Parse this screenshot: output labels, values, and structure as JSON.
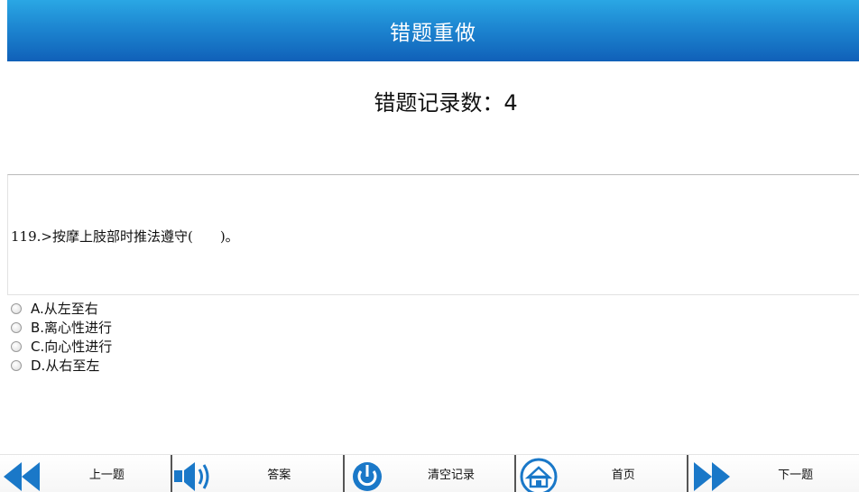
{
  "header": {
    "title": "错题重做"
  },
  "summary": {
    "record_count_text": "错题记录数：4"
  },
  "question": {
    "text": "119.>按摩上肢部时推法遵守(　　)。",
    "options": [
      {
        "label": "A.从左至右"
      },
      {
        "label": "B.离心性进行"
      },
      {
        "label": "C.向心性进行"
      },
      {
        "label": "D.从右至左"
      }
    ]
  },
  "toolbar": {
    "items": [
      {
        "label": "上一题",
        "icon": "previous-icon"
      },
      {
        "label": "答案",
        "icon": "speaker-icon"
      },
      {
        "label": "清空记录",
        "icon": "power-icon"
      },
      {
        "label": "首页",
        "icon": "home-icon"
      },
      {
        "label": "下一题",
        "icon": "next-icon"
      }
    ]
  },
  "colors": {
    "header_top": "#2aa7e4",
    "header_bottom": "#1060b8",
    "icon_blue": "#1a78c8"
  }
}
